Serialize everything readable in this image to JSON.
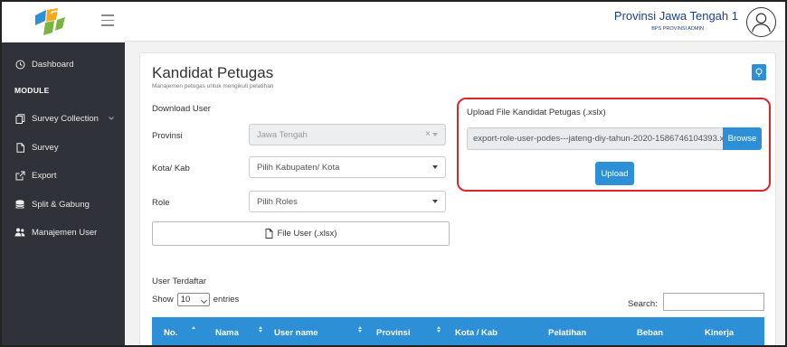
{
  "header": {
    "user_name": "Provinsi Jawa Tengah 1",
    "user_role": "BPS PROVINSI ADMIN"
  },
  "sidebar": {
    "module_label": "MODULE",
    "items": [
      {
        "label": "Dashboard",
        "icon": "clock-icon"
      },
      {
        "label": "Survey Collection",
        "icon": "copy-icon"
      },
      {
        "label": "Survey",
        "icon": "file-icon"
      },
      {
        "label": "Export",
        "icon": "external-link-icon"
      },
      {
        "label": "Split & Gabung",
        "icon": "database-icon"
      },
      {
        "label": "Manajemen User",
        "icon": "users-icon"
      }
    ]
  },
  "page": {
    "title": "Kandidat Petugas",
    "subtitle": "Manajemen petugas untuk mengikuti pelatihan"
  },
  "download": {
    "section_label": "Download User",
    "provinsi_label": "Provinsi",
    "provinsi_value": "Jawa Tengah",
    "provinsi_clear": "×",
    "kota_label": "Kota/ Kab",
    "kota_placeholder": "Pilih Kabupaten/ Kota",
    "role_label": "Role",
    "role_placeholder": "Pilih Roles",
    "file_button": "File User (.xlsx)"
  },
  "upload": {
    "title": "Upload File Kandidat Petugas (.xslx)",
    "file_name": "export-role-user-podes---jateng-diy-tahun-2020-1586746104393.x",
    "browse_label": "Browse",
    "upload_label": "Upload"
  },
  "table": {
    "section_label": "User Terdaftar",
    "show_label": "Show",
    "length_value": "10",
    "entries_label": "entries",
    "search_label": "Search:",
    "columns": [
      "No.",
      "Nama",
      "User name",
      "Provinsi",
      "Kota / Kab",
      "Pelatihan",
      "Beban",
      "Kinerja"
    ]
  },
  "colors": {
    "primary": "#2d8fd6",
    "sidebar_bg": "#2f3238",
    "highlight": "#d8262c",
    "user_name": "#1a3e8c"
  }
}
